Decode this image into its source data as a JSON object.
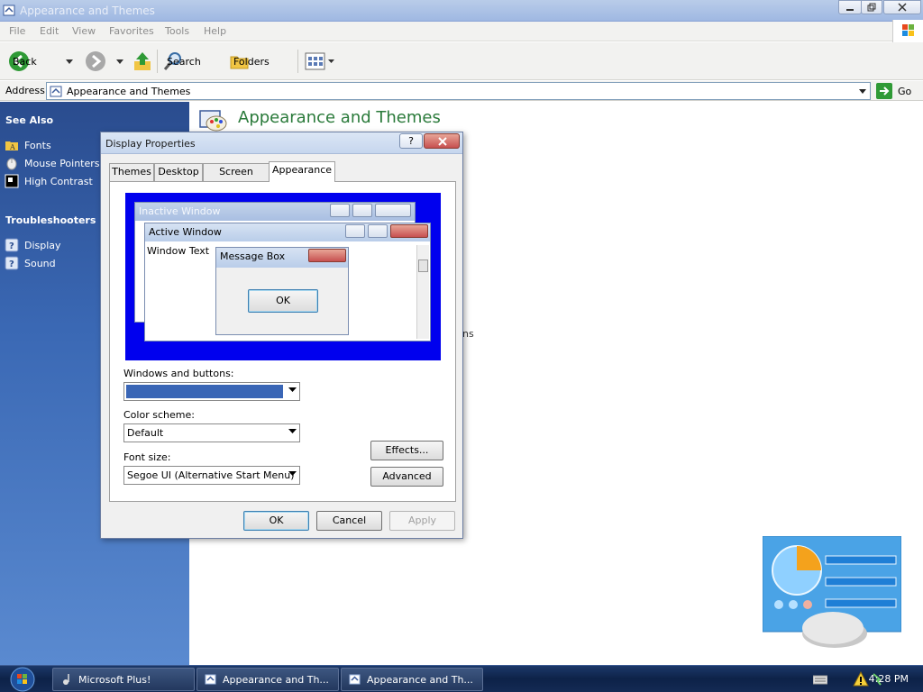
{
  "window": {
    "title": "Appearance and Themes"
  },
  "menu": [
    "File",
    "Edit",
    "View",
    "Favorites",
    "Tools",
    "Help"
  ],
  "toolbar": {
    "back": "Back",
    "search": "Search",
    "folders": "Folders"
  },
  "address": {
    "label": "Address",
    "value": "Appearance and Themes",
    "go": "Go"
  },
  "taskpane": {
    "see_also": "See Also",
    "see_also_items": [
      "Fonts",
      "Mouse Pointers",
      "High Contrast"
    ],
    "troubleshooters": "Troubleshooters",
    "troubleshooter_items": [
      "Display",
      "Sound"
    ]
  },
  "main": {
    "title": "Appearance and Themes",
    "ghost_text": "ns"
  },
  "dialog": {
    "title": "Display Properties",
    "help": "?",
    "tabs": [
      "Themes",
      "Desktop",
      "Screen Saver",
      "Appearance"
    ],
    "preview": {
      "inactive": "Inactive Window",
      "active": "Active Window",
      "window_text": "Window Text",
      "message_box": "Message Box",
      "ok": "OK"
    },
    "windows_buttons_label": "Windows and buttons:",
    "windows_buttons_value": "",
    "color_scheme_label": "Color scheme:",
    "color_scheme_value": "Default",
    "font_size_label": "Font size:",
    "font_size_value": "Segoe UI (Alternative Start Menu)",
    "effects": "Effects...",
    "advanced": "Advanced",
    "ok": "OK",
    "cancel": "Cancel",
    "apply": "Apply"
  },
  "taskbar": {
    "buttons": [
      "Microsoft Plus!",
      "Appearance and Th...",
      "Appearance and Th..."
    ],
    "clock": "4:28 PM"
  },
  "colors": {
    "taskpane": "#3a68b4",
    "preview_bg": "#0000ee",
    "title_green": "#2a7a3a"
  }
}
